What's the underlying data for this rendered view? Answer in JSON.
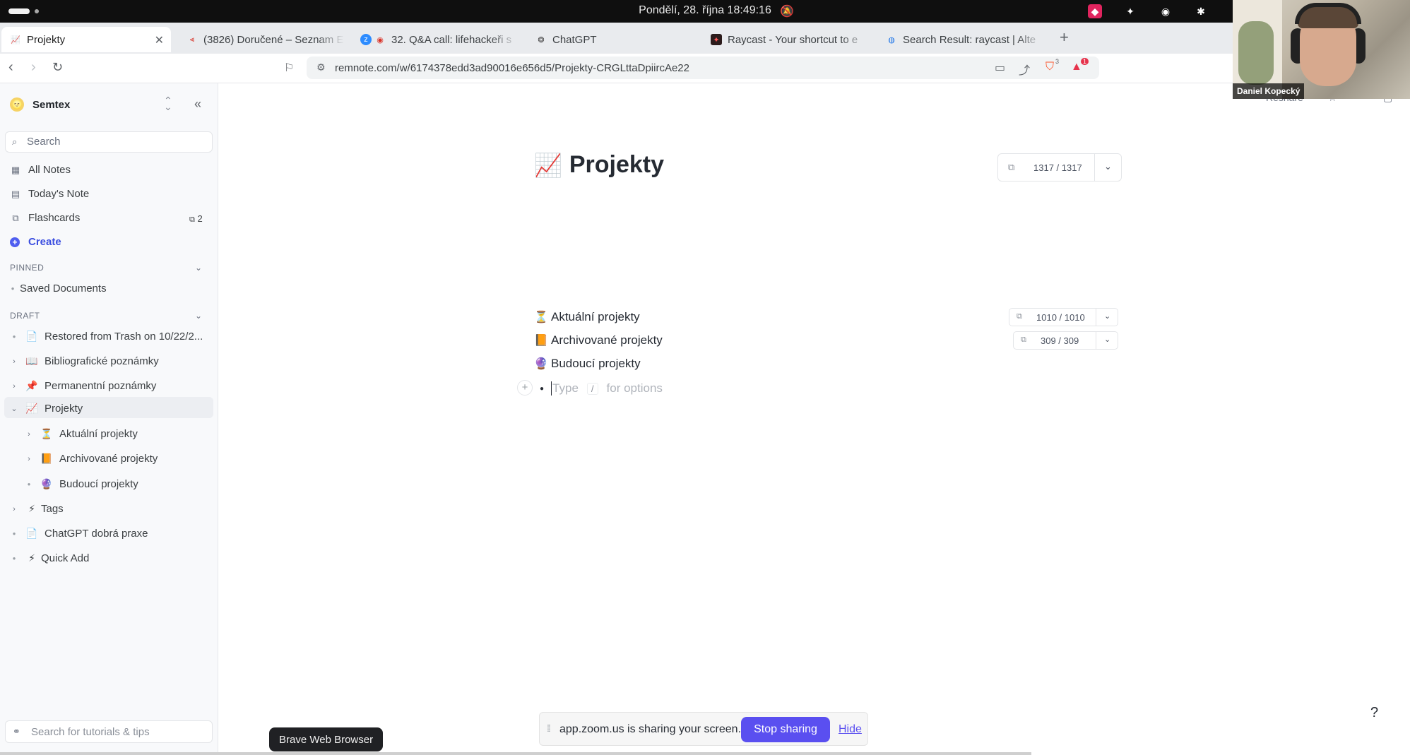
{
  "os_bar": {
    "clock": "Pondělí, 28. října  18:49:16"
  },
  "tabs": [
    {
      "title": "Projekty",
      "icon": "remnote-icon",
      "active": true
    },
    {
      "title": "(3826) Doručené – Seznam E",
      "icon": "seznam-icon"
    },
    {
      "title": "32. Q&A call: lifehackeři s",
      "icon": "zoom-icon"
    },
    {
      "title": "ChatGPT",
      "icon": "chatgpt-icon"
    },
    {
      "title": "Raycast - Your shortcut to e",
      "icon": "raycast-icon"
    },
    {
      "title": "Search Result: raycast | Alte",
      "icon": "search-result-icon"
    }
  ],
  "address_bar": {
    "url": "remnote.com/w/6174378edd3ad90016e656d5/Projekty-CRGLttaDpiircAe22",
    "brave_shield_count": "3",
    "rewards_count": "1"
  },
  "sidebar": {
    "workspace": "Semtex",
    "search_placeholder": "Search",
    "nav": [
      {
        "label": "All Notes",
        "icon": "grid-icon"
      },
      {
        "label": "Today's Note",
        "icon": "calendar-icon"
      },
      {
        "label": "Flashcards",
        "icon": "flashcards-icon",
        "count": "2"
      },
      {
        "label": "Create",
        "icon": "plus-circle-icon"
      }
    ],
    "pinned_header": "PINNED",
    "pinned": [
      {
        "label": "Saved Documents"
      }
    ],
    "draft_header": "DRAFT",
    "draft": [
      {
        "label": "Restored from Trash on 10/22/2...",
        "emoji": "📄"
      },
      {
        "label": "Bibliografické poznámky",
        "emoji": "📖"
      },
      {
        "label": "Permanentní poznámky",
        "emoji": "📌"
      },
      {
        "label": "Projekty",
        "emoji": "📈"
      },
      {
        "label": "Aktuální projekty",
        "emoji": "⏳"
      },
      {
        "label": "Archivované projekty",
        "emoji": "📙"
      },
      {
        "label": "Budoucí projekty",
        "emoji": "🔮"
      },
      {
        "label": "Tags",
        "emoji": "⚡"
      },
      {
        "label": "ChatGPT dobrá praxe",
        "emoji": "📄"
      },
      {
        "label": "Quick Add",
        "emoji": "⚡"
      }
    ],
    "tips_placeholder": "Search for tutorials & tips"
  },
  "main": {
    "title": "Projekty",
    "title_emoji": "📈",
    "counter": "1317 / 1317",
    "reshare": "Reshare",
    "rems": [
      {
        "label": "Aktuální projekty",
        "emoji": "⏳",
        "counter": "1010 / 1010"
      },
      {
        "label": "Archivované projekty",
        "emoji": "📙",
        "counter": "309 / 309"
      },
      {
        "label": "Budoucí projekty",
        "emoji": "🔮"
      }
    ],
    "type_hint": {
      "a": "Type",
      "slash": "/",
      "b": "for options"
    },
    "help": "?"
  },
  "share_bar": {
    "message": "app.zoom.us is sharing your screen.",
    "stop": "Stop sharing",
    "hide": "Hide"
  },
  "taskbar_tooltip": "Brave Web Browser",
  "webcam": {
    "name": "Daniel Kopecký"
  }
}
